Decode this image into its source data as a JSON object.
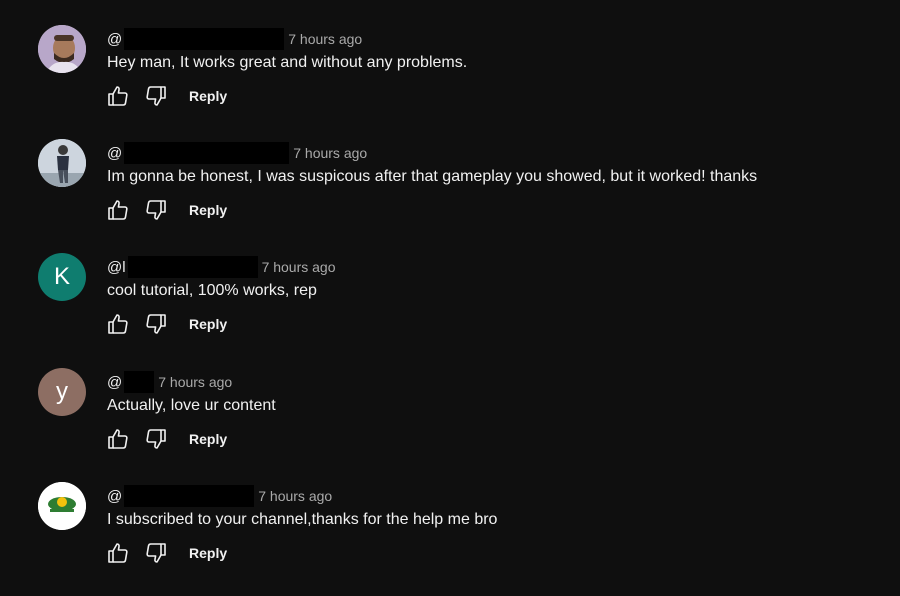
{
  "comments": [
    {
      "handle": "@",
      "time": "7 hours ago",
      "text": "Hey man, It works great and without any problems.",
      "avatar_letter": "",
      "avatar_type": "photo-man",
      "avatar_color": "#c9b8d3",
      "reply_label": "Reply"
    },
    {
      "handle": "@",
      "time": "7 hours ago",
      "text": "Im gonna be honest, I was suspicous after that gameplay you showed, but it worked! thanks",
      "avatar_letter": "",
      "avatar_type": "photo-person",
      "avatar_color": "#c8d2dc",
      "reply_label": "Reply"
    },
    {
      "handle": "@l",
      "time": "7 hours ago",
      "text": "cool tutorial, 100% works,  rep",
      "avatar_letter": "K",
      "avatar_type": "letter",
      "avatar_color": "#0f7d6f",
      "reply_label": "Reply"
    },
    {
      "handle": "@",
      "time": "7 hours ago",
      "text": "Actually, love ur content",
      "avatar_letter": "y",
      "avatar_type": "letter",
      "avatar_color": "#8d6e63",
      "reply_label": "Reply"
    },
    {
      "handle": "@",
      "time": "7 hours ago",
      "text": "I subscribed to your channel,thanks for the help me bro",
      "avatar_letter": "",
      "avatar_type": "logo",
      "avatar_color": "#ffffff",
      "reply_label": "Reply"
    }
  ],
  "icons": {
    "like": "thumbs-up-icon",
    "dislike": "thumbs-down-icon"
  }
}
